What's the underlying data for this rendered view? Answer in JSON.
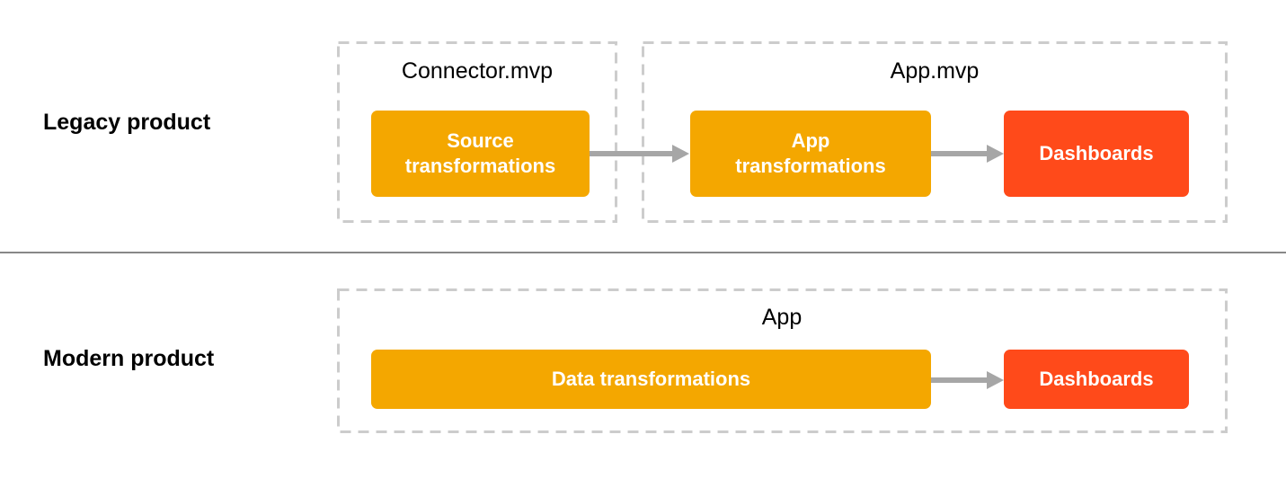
{
  "colors": {
    "transform": "#F4A700",
    "dashboard": "#FF4A1A",
    "arrow": "#A6A6A6",
    "group_border": "#CCCCCC",
    "divider": "#888888"
  },
  "legacy": {
    "label": "Legacy product",
    "groups": [
      {
        "title": "Connector.mvp"
      },
      {
        "title": "App.mvp"
      }
    ],
    "nodes": [
      {
        "line1": "Source",
        "line2": "transformations"
      },
      {
        "line1": "App",
        "line2": "transformations"
      },
      {
        "line1": "Dashboards"
      }
    ]
  },
  "modern": {
    "label": "Modern product",
    "groups": [
      {
        "title": "App"
      }
    ],
    "nodes": [
      {
        "line1": "Data transformations"
      },
      {
        "line1": "Dashboards"
      }
    ]
  }
}
